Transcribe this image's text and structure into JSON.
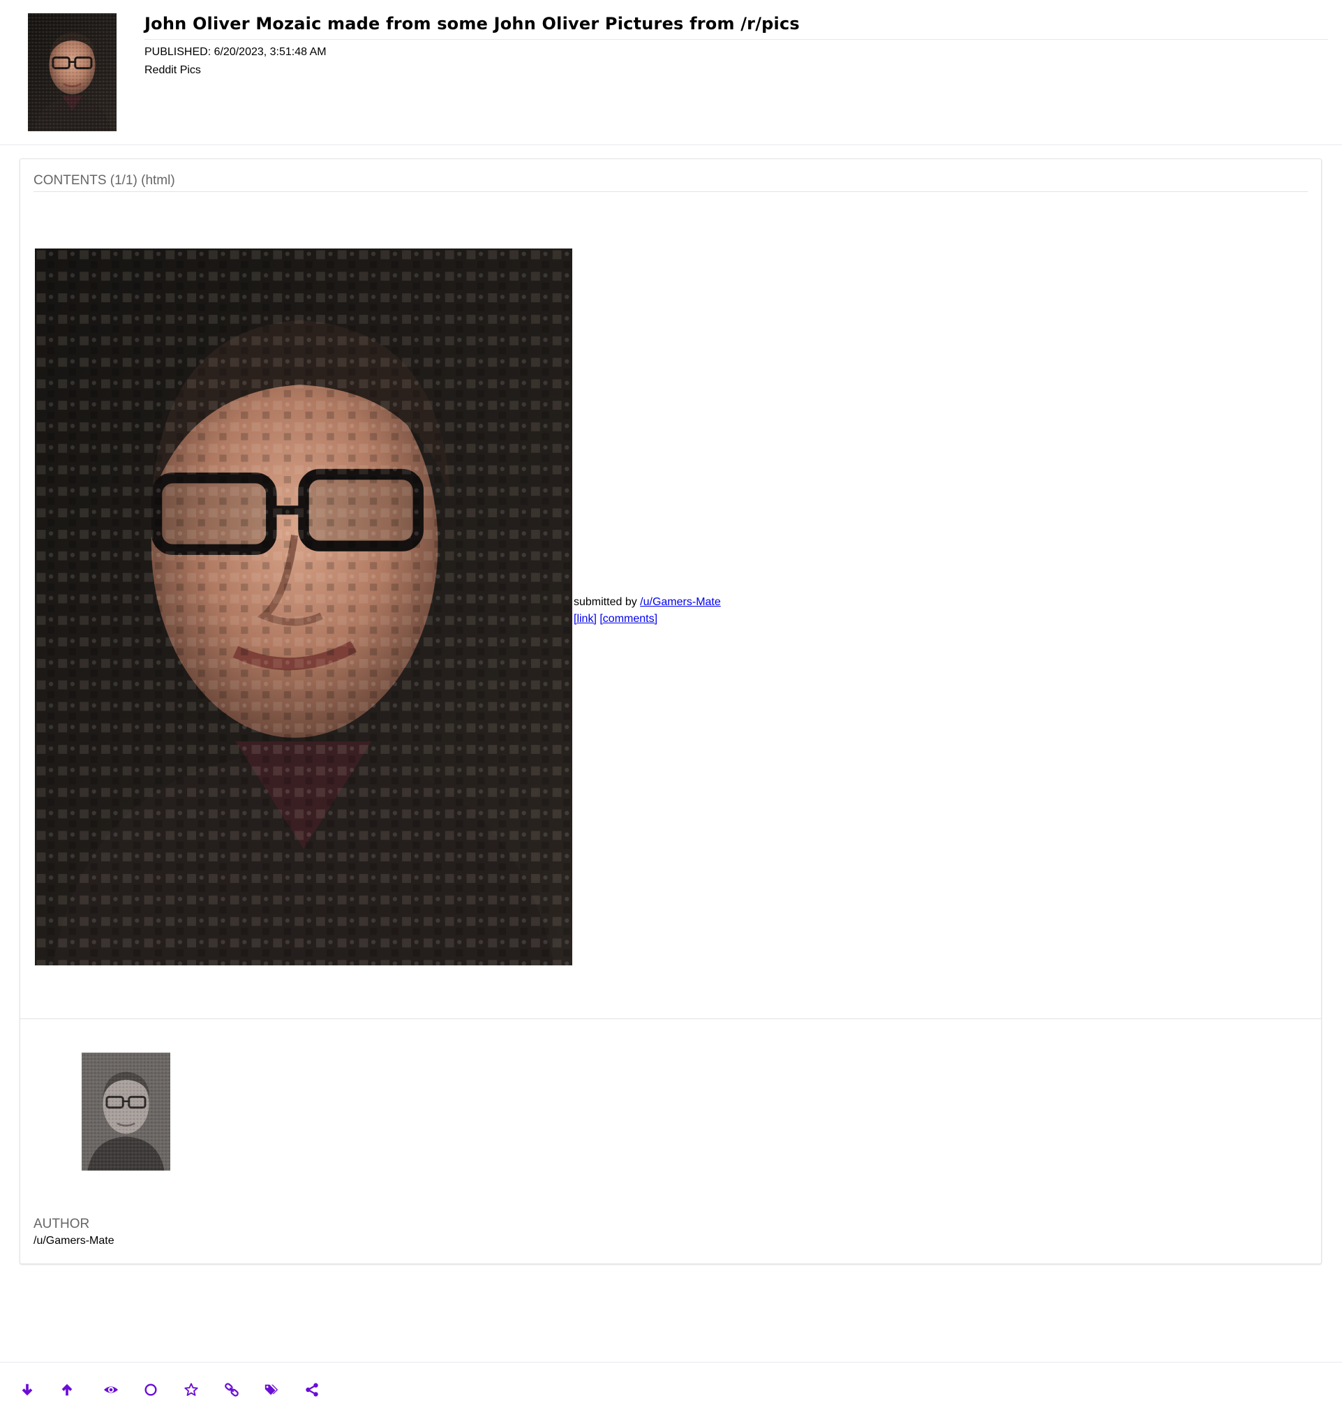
{
  "post": {
    "title": "John Oliver Mozaic made from some John Oliver Pictures from /r/pics",
    "published": "PUBLISHED: 6/20/2023, 3:51:48 AM",
    "feed": "Reddit Pics"
  },
  "contents": {
    "label": "CONTENTS (1/1) (html)",
    "submitted_prefix": "submitted by",
    "author_link": "/u/Gamers-Mate",
    "link_label": "[link]",
    "comments_label": "[comments]"
  },
  "author": {
    "label": "AUTHOR",
    "name": "/u/Gamers-Mate"
  },
  "toolbar": {
    "accent": "#6a0dd6",
    "icons": [
      "arrow-down-icon",
      "arrow-up-icon",
      "eye-icon",
      "circle-icon",
      "star-icon",
      "link-icon",
      "tags-icon",
      "share-icon"
    ]
  },
  "colors": {
    "link": "#0000ee",
    "muted": "#666666"
  }
}
